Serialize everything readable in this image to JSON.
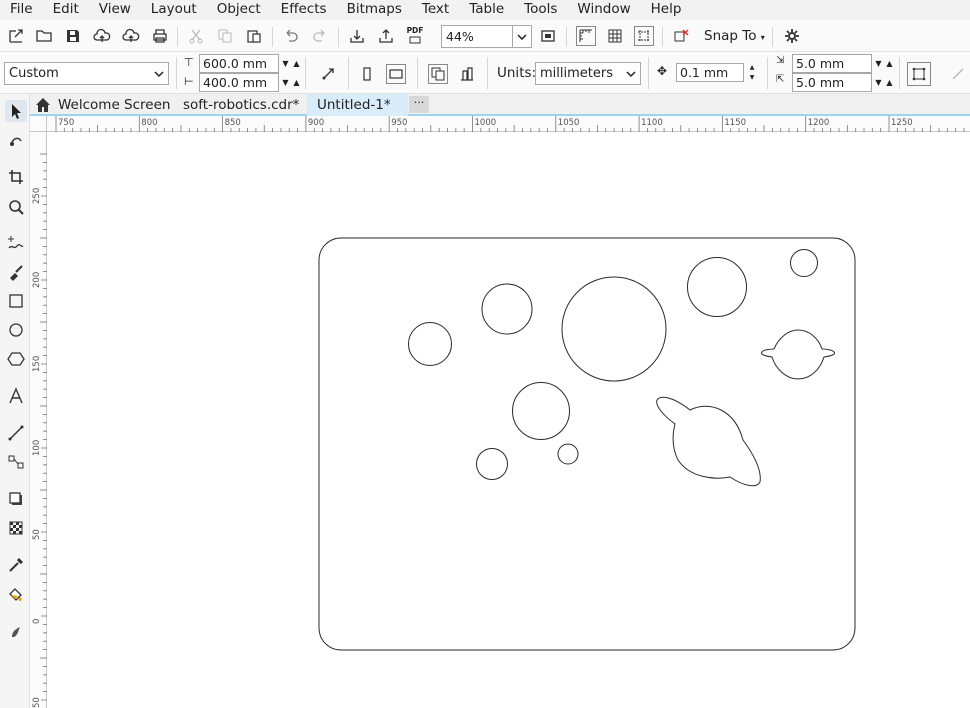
{
  "menu": [
    "File",
    "Edit",
    "View",
    "Layout",
    "Object",
    "Effects",
    "Bitmaps",
    "Text",
    "Table",
    "Tools",
    "Window",
    "Help"
  ],
  "toolbar": {
    "zoom": "44%",
    "snap_to": "Snap To",
    "pdf_label": "PDF",
    "icons": [
      "new-document-icon",
      "open-folder-icon",
      "save-icon",
      "upload-cloud-icon",
      "cloud-sync-icon",
      "print-icon",
      "cut-icon",
      "copy-icon",
      "paste-icon",
      "undo-icon",
      "redo-icon",
      "import-icon",
      "export-icon",
      "publish-pdf-icon",
      "full-screen-icon",
      "rulers-icon",
      "grid-icon",
      "guidelines-icon",
      "alignment-guides-icon",
      "options-icon"
    ]
  },
  "propbar": {
    "page_size": "Custom",
    "width": "600.0 mm",
    "height": "400.0 mm",
    "units_label": "Units:",
    "units": "millimeters",
    "nudge": "0.1 mm",
    "dup_x": "5.0 mm",
    "dup_y": "5.0 mm"
  },
  "tabs": [
    {
      "label": "Welcome Screen"
    },
    {
      "label": "soft-robotics.cdr*"
    },
    {
      "label": "Untitled-1*",
      "active": true
    }
  ],
  "more_tabs": "···",
  "toolbox": [
    "pick-tool-icon",
    "shape-tool-icon",
    "crop-tool-icon",
    "zoom-tool-icon",
    "freehand-tool-icon",
    "artistic-media-icon",
    "rectangle-tool-icon",
    "ellipse-tool-icon",
    "polygon-tool-icon",
    "text-tool-icon",
    "parallel-dimension-icon",
    "connector-tool-icon",
    "drop-shadow-icon",
    "transparency-tool-icon",
    "eyedropper-icon",
    "interactive-fill-icon",
    "smart-fill-icon"
  ],
  "hruler_labels": [
    "750",
    "800",
    "850",
    "900",
    "950",
    "1000",
    "1050",
    "1100",
    "1150",
    "1200",
    "1250"
  ],
  "vruler_labels": [
    "250",
    "200",
    "150",
    "100",
    "50",
    "0",
    "50"
  ],
  "colors": {
    "accent": "#9fd4f0",
    "active_tab": "#d9ecfa",
    "outline": "#2a2a2a"
  }
}
